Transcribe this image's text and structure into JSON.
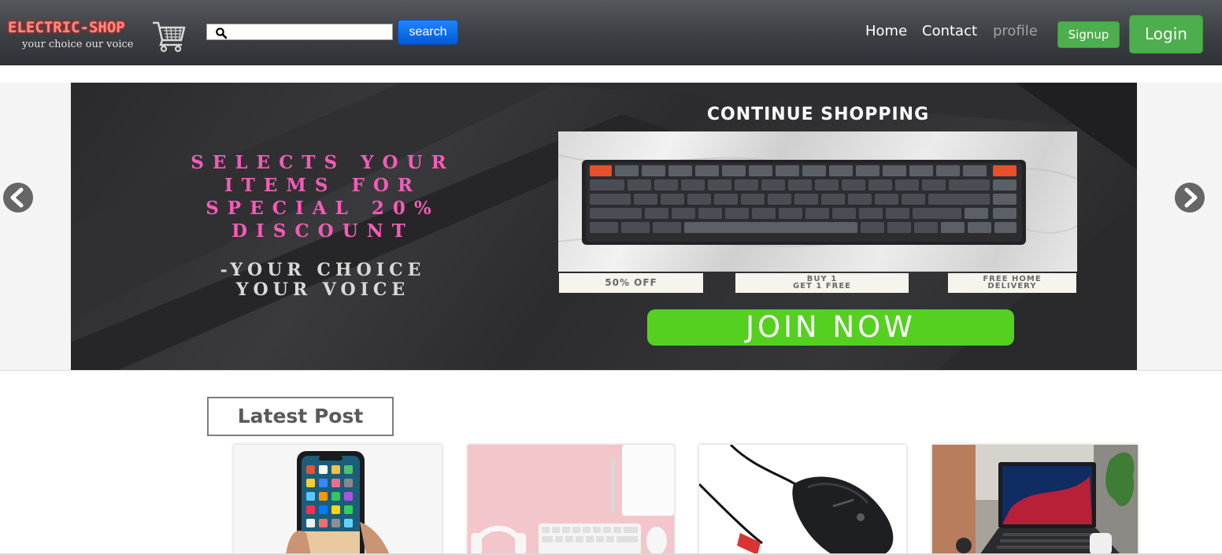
{
  "navbar": {
    "logo_title": "ELECTRIC-SHOP",
    "logo_subtitle": "your  choice our voice",
    "search_placeholder": "",
    "search_value": "",
    "search_button": "search",
    "links": {
      "home": "Home",
      "contact": "Contact",
      "profile": "profile"
    },
    "signup": "Signup",
    "login": "Login"
  },
  "carousel": {
    "promo_lines": [
      "SELECTS YOUR",
      "ITEMS FOR",
      "SPECIAL 20%",
      "DISCOUNT"
    ],
    "slogan_lines": [
      "-YOUR CHOICE",
      "YOUR VOICE"
    ],
    "continue_title": "CONTINUE SHOPPING",
    "offers": {
      "off": "50% OFF",
      "buy_line1": "BUY 1",
      "buy_line2": "GET 1 FREE",
      "free_line1": "FREE HOME",
      "free_line2": "DELIVERY"
    },
    "join_button": "JOIN NOW"
  },
  "latest": {
    "title": "Latest Post"
  },
  "colors": {
    "navbar_bg": "#3c3f43",
    "search_button": "#0a6ae6",
    "nav_button_green": "#4cae4c",
    "promo_pink": "#f55bb8",
    "join_green": "#55d021",
    "slide_bg": "#2c2c2e"
  },
  "icons": {
    "cart": "shopping-cart-icon",
    "search": "search-icon",
    "prev": "chevron-left-circle-icon",
    "next": "chevron-right-circle-icon"
  }
}
